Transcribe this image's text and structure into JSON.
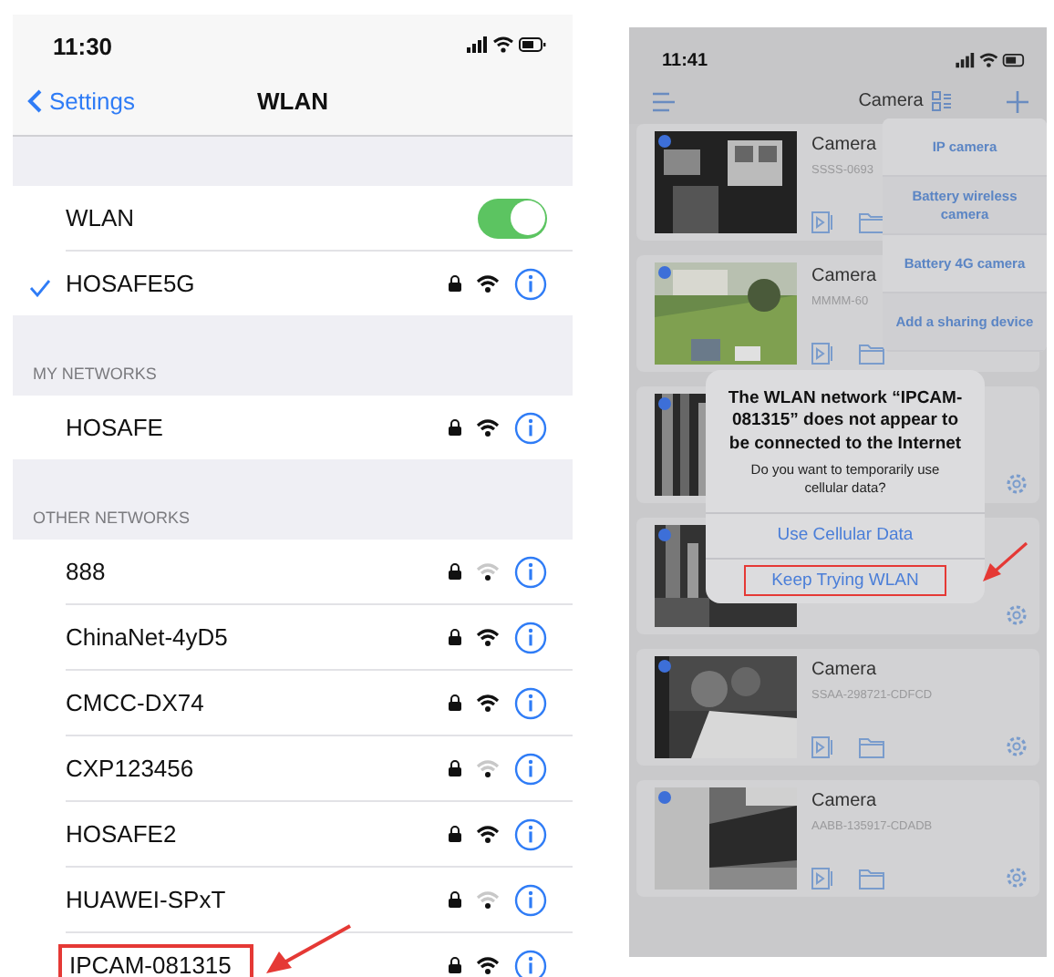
{
  "wifi_screen": {
    "status_bar": {
      "time": "11:30"
    },
    "nav": {
      "back": "Settings",
      "title": "WLAN"
    },
    "wlan_toggle": {
      "label": "WLAN",
      "on": true
    },
    "connected": {
      "name": "HOSAFE5G",
      "checked": true
    },
    "sections": [
      {
        "header": "MY NETWORKS",
        "networks": [
          {
            "name": "HOSAFE",
            "weak": false,
            "highlighted": false
          }
        ]
      },
      {
        "header": "OTHER NETWORKS",
        "networks": [
          {
            "name": "888",
            "weak": true,
            "highlighted": false
          },
          {
            "name": "ChinaNet-4yD5",
            "weak": false,
            "highlighted": false
          },
          {
            "name": "CMCC-DX74",
            "weak": false,
            "highlighted": false
          },
          {
            "name": "CXP123456",
            "weak": true,
            "highlighted": false
          },
          {
            "name": "HOSAFE2",
            "weak": false,
            "highlighted": false
          },
          {
            "name": "HUAWEI-SPxT",
            "weak": true,
            "highlighted": false
          },
          {
            "name": "IPCAM-081315",
            "weak": false,
            "highlighted": true
          }
        ]
      }
    ]
  },
  "camera_screen": {
    "status_bar": {
      "time": "11:41"
    },
    "title": "Camera",
    "cameras": [
      {
        "name": "Camera",
        "serial": "SSSS-0693",
        "online": true,
        "tools": true,
        "gear": false
      },
      {
        "name": "Camera",
        "serial": "MMMM-60",
        "online": true,
        "tools": true,
        "gear": false
      },
      {
        "online": true,
        "tools": false,
        "gear": true
      },
      {
        "online": true,
        "tools": false,
        "gear": true
      },
      {
        "name": "Camera",
        "serial": "SSAA-298721-CDFCD",
        "online": true,
        "tools": true,
        "gear": true
      },
      {
        "name": "Camera",
        "serial": "AABB-135917-CDADB",
        "online": true,
        "tools": true,
        "gear": true
      }
    ],
    "add_menu": {
      "items": [
        "IP camera",
        "Battery wireless camera",
        "Battery 4G camera",
        "Add a sharing device"
      ]
    },
    "alert": {
      "title": "The WLAN network “IPCAM-081315” does not appear to be connected to the Internet",
      "message": "Do you want to temporarily use cellular data?",
      "buttons": [
        {
          "label": "Use Cellular Data",
          "highlighted": false
        },
        {
          "label": "Keep Trying WLAN",
          "highlighted": true
        }
      ]
    }
  }
}
